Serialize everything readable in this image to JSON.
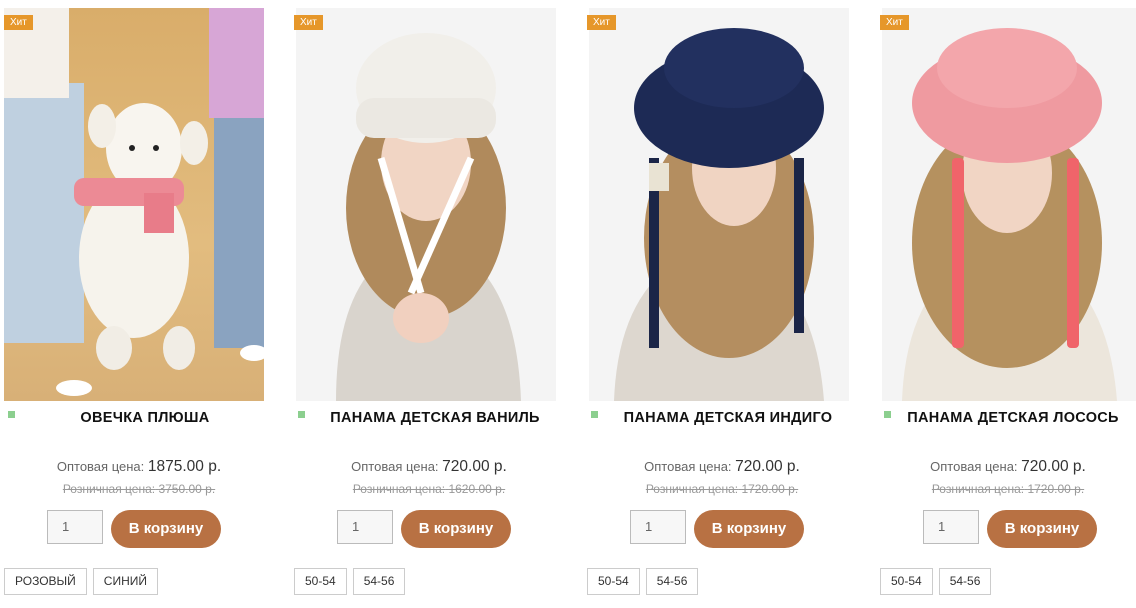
{
  "labels": {
    "badge": "Хит",
    "price_label": "Оптовая цена:",
    "retail_label": "Розничная цена:",
    "cart_button": "В корзину",
    "qty_default": "1"
  },
  "products": [
    {
      "title": "ОВЕЧКА ПЛЮША",
      "wholesale": "1875.00 р.",
      "retail": "3750.00 р.",
      "options": [
        "РОЗОВЫЙ",
        "СИНИЙ"
      ]
    },
    {
      "title": "ПАНАМА ДЕТСКАЯ ВАНИЛЬ",
      "wholesale": "720.00 р.",
      "retail": "1620.00 р.",
      "options": [
        "50-54",
        "54-56"
      ]
    },
    {
      "title": "ПАНАМА ДЕТСКАЯ ИНДИГО",
      "wholesale": "720.00 р.",
      "retail": "1720.00 р.",
      "options": [
        "50-54",
        "54-56"
      ]
    },
    {
      "title": "ПАНАМА ДЕТСКАЯ ЛОСОСЬ",
      "wholesale": "720.00 р.",
      "retail": "1720.00 р.",
      "options": [
        "50-54",
        "54-56"
      ]
    }
  ],
  "colors": {
    "badge": "#e6972a",
    "cart_button": "#b87143",
    "stock_dot": "#8ccf8f"
  }
}
